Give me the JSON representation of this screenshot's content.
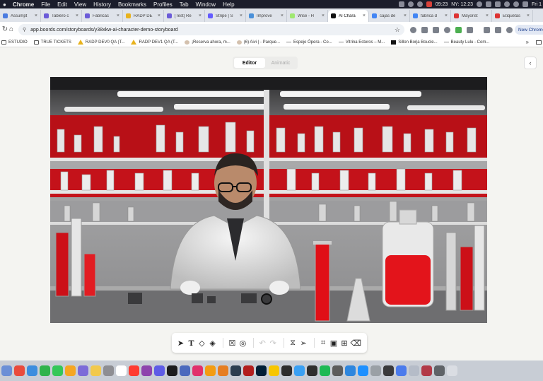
{
  "menubar": {
    "app": "Chrome",
    "items": [
      "File",
      "Edit",
      "View",
      "History",
      "Bookmarks",
      "Profiles",
      "Tab",
      "Window",
      "Help"
    ],
    "clock_local": "09:23",
    "clock_ny": "NY: 12:23",
    "day": "Fri 1"
  },
  "tabs": [
    {
      "label": "Assumpt",
      "color": "#4a7be0",
      "active": false
    },
    {
      "label": "Tablero c",
      "color": "#6b5bd8",
      "active": false
    },
    {
      "label": "Fabricac",
      "color": "#6b5bd8",
      "active": false
    },
    {
      "label": "RADP DE",
      "color": "#e8b21c",
      "active": false
    },
    {
      "label": "[Test] Re",
      "color": "#6b5bd8",
      "active": false
    },
    {
      "label": "Stripe | S",
      "color": "#635bff",
      "active": false
    },
    {
      "label": "Improve",
      "color": "#4a90d9",
      "active": false
    },
    {
      "label": "Wise - H",
      "color": "#9fe870",
      "active": false
    },
    {
      "label": "AI Chara",
      "color": "#111111",
      "active": true
    },
    {
      "label": "cajas de",
      "color": "#4285f4",
      "active": false
    },
    {
      "label": "fabrica d",
      "color": "#4285f4",
      "active": false
    },
    {
      "label": "Mayorist",
      "color": "#d33",
      "active": false
    },
    {
      "label": "Etiquetas",
      "color": "#d33",
      "active": false
    }
  ],
  "address": {
    "url": "app.boords.com/storyboards/y38xkw-ai-character-demo-storyboard",
    "new_chrome": "New Chrome"
  },
  "bookmarks": [
    {
      "label": "ESTUDIO",
      "icon": "folder"
    },
    {
      "label": "TRUE TICKETS",
      "icon": "folder"
    },
    {
      "label": "RADP DEV0 QA (T...",
      "icon": "warn"
    },
    {
      "label": "RADP DEV1 QA (T...",
      "icon": "warn"
    },
    {
      "label": "¡Reserva ahora, m...",
      "icon": "sq"
    },
    {
      "label": "(6) Aivi | - Parque...",
      "icon": "sq"
    },
    {
      "label": "Espejo Ópera - Co...",
      "icon": "dash"
    },
    {
      "label": "Vitrina Esteros – M...",
      "icon": "dash"
    },
    {
      "label": "Sillon Borja Boucle...",
      "icon": "dark"
    },
    {
      "label": "Beauty Lulu - Com...",
      "icon": "dash"
    }
  ],
  "editor": {
    "mode_tabs": [
      "Editor",
      "Animatic"
    ],
    "active_mode": "Editor"
  },
  "image": {
    "subject": "scientist in lab coat with red-liquid glassware",
    "accent_color": "#d8131a"
  },
  "toolbar": {
    "tools": [
      "select-cursor",
      "text",
      "eraser",
      "paint-bucket",
      "delete-box",
      "lasso",
      "undo",
      "redo",
      "flip",
      "send",
      "crop",
      "image-replace",
      "add-frame",
      "trash"
    ]
  }
}
